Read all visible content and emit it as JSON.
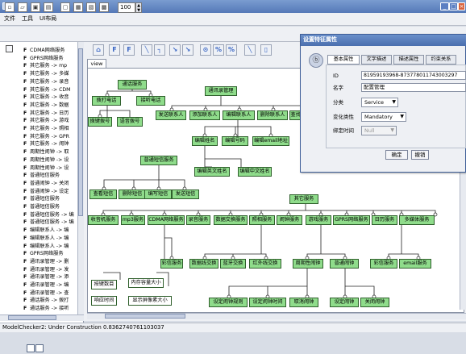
{
  "window": {
    "min": "_",
    "max": "□",
    "close": "×"
  },
  "menu": [
    "文件",
    "工具",
    "UI布局"
  ],
  "toolbar": {
    "zoom": "100"
  },
  "view_tab": "view",
  "status": "ModelChecker2: Under Construction 0.8362740761103037",
  "tree": [
    "CDMA网络服务",
    "GPRS网络服务",
    "其它服务 -> mp",
    "其它服务 -> 多媒",
    "其它服务 -> 录音",
    "其它服务 -> CDM",
    "其它服务 -> 收音",
    "其它服务 -> 数据",
    "其它服务 -> 日历",
    "其它服务 -> 游戏",
    "其它服务 -> 照相",
    "其它服务 -> GPR",
    "其它服务 -> 闹钟",
    "周期性闹钟 -> 取",
    "周期性闹钟 -> 设",
    "周期性闹钟 -> 设",
    "普通短信服务",
    "普通闹钟 -> 关闭",
    "普通闹钟 -> 设定",
    "普通短信服务",
    "普通短信服务",
    "普通短信服务 -> 编",
    "普通短信服务 -> 编",
    "编辑联系人 -> 编",
    "编辑联系人 -> 编",
    "编辑联系人 -> 编",
    "GPRS网络服务",
    "通讯录管理 -> 删",
    "通讯录管理 -> 发",
    "通讯录管理 -> 添",
    "通讯录管理 -> 编",
    "通讯录管理 -> 查",
    "通话服务 -> 拨打",
    "通话服务 -> 接听"
  ],
  "nodes": {
    "n_call": "通话服务",
    "n_contacts": "通讯录管理",
    "n_dial": "拨打电话",
    "n_answer": "接听电话",
    "n_dialnum": "拨键拨号",
    "n_voicedial": "语音拨号",
    "n_send": "发送联系人",
    "n_add": "添加联系人",
    "n_edit": "编辑联系人",
    "n_delete": "删除联系人",
    "n_search": "查找联系人",
    "n_editname": "编辑姓名",
    "n_editnum": "编辑号码",
    "n_editemail": "编辑email地址",
    "n_editen": "编辑英文姓名",
    "n_editcn": "编辑中文姓名",
    "n_sms": "普通短信服务",
    "n_view": "查看短信",
    "n_delsms": "删除短信",
    "n_write": "编写短信",
    "n_sendsms": "发送短信",
    "n_other": "其它服务",
    "n_radio": "收音机服务",
    "n_mp3": "mp3服务",
    "n_cdma": "CDMA网络服务",
    "n_record": "录音服务",
    "n_data": "数据交换服务",
    "n_camera": "照相服务",
    "n_alarm": "闹钟服务",
    "n_game": "游戏服务",
    "n_gprs": "GPRS网络服务",
    "n_calendar": "日历服务",
    "n_media": "多媒体服务",
    "n_video": "彩信服务",
    "n_datasw": "数据线交换",
    "n_bt": "蓝牙交换",
    "n_ir": "红外线交换",
    "n_period": "周期性闹钟",
    "n_normal": "普通闹钟",
    "n_mms": "彩信服务",
    "n_email": "email服务",
    "n_setrule": "设定闹钟规则",
    "n_settime": "设定闹钟时间",
    "n_cancel": "取消闹钟",
    "n_setalarm": "设定闹钟",
    "n_close": "关闭闹钟"
  },
  "notes": {
    "note1": "按键数目",
    "note2": "内存容量大小",
    "note3": "响应时间",
    "note4": "显示屏像素大小"
  },
  "dialog": {
    "title": "设置特征属性",
    "tabs": [
      "基本属性",
      "文字描述",
      "描述属性",
      "约束关系"
    ],
    "id_label": "ID",
    "id_value": "81959193968-873778011743003297",
    "name_label": "名字",
    "name_value": "配置管理",
    "category_label": "分类",
    "category_value": "Service",
    "variability_label": "变化类性",
    "variability_value": "Mandatory",
    "binding_label": "绑定时间",
    "binding_value": "Null",
    "ok": "确定",
    "cancel": "撤销"
  }
}
